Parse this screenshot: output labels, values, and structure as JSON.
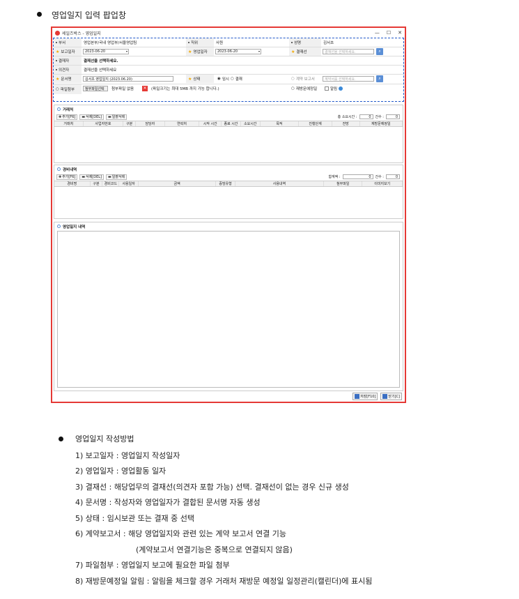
{
  "heading": "영업일지 입력 팝업창",
  "window": {
    "title": "세일즈박스 - 영업일지",
    "controls": [
      "—",
      "☐",
      "✕"
    ],
    "form": {
      "dept_label": "부서",
      "dept_value": "영업본부/국내 영업부/서울영업팀",
      "position_label": "직위",
      "position_value": "사원",
      "name_label": "성명",
      "name_value": "김서초",
      "report_date_label": "보고일자",
      "report_date_value": "2023-06-20",
      "sales_date_label": "영업일자",
      "sales_date_value": "2023-06-20",
      "approval_label": "결재선",
      "approval_placeholder": "결재선을 선택하세요.",
      "approver_label": "결재자",
      "approver_value": "결재선을 선택하세요.",
      "reviewer_label": "의견자",
      "reviewer_value": "결재선을 선택하세요",
      "docname_label": "문서명",
      "docname_value": "김서초 영업일지 (2023.06.20)",
      "status_label": "상태",
      "status_opt1": "임시",
      "status_opt2": "결재",
      "contract_label": "계약 보고서",
      "contract_placeholder": "계약서를 선택하세요.",
      "attach_label": "파일첨부",
      "attach_btn": "첨부파일선택",
      "attach_none": "첨부파일 없음",
      "attach_note": "(파일크기는 최대 5MB 까지 가능 합니다.)",
      "revisit_label": "재방문예정일",
      "alarm_label": "알림"
    },
    "client": {
      "title": "거래처",
      "add": "추가[F6]",
      "del": "삭제[DEL]",
      "delall": "일괄삭제",
      "total_time_label": "총 소요시간 :",
      "total_time": "0",
      "count_label": "건수 :",
      "count": "0",
      "columns": [
        "거래처",
        "사업자번호",
        "구분",
        "담당자",
        "연락처",
        "시작 시간",
        "종료 시간",
        "소요시간",
        "목적",
        "진행단계",
        "전망",
        "재방문예정일"
      ]
    },
    "expense": {
      "title": "경비내역",
      "add": "추가[F6]",
      "del": "삭제[DEL]",
      "delall": "일괄삭제",
      "sum_label": "합계액 :",
      "sum": "0",
      "count_label": "건수 :",
      "count": "0",
      "columns": [
        "경비명",
        "구분",
        "경비코드",
        "사용일자",
        "금액",
        "증빙유형",
        "사용내역",
        "첨부파일",
        "이미지보기"
      ]
    },
    "content": {
      "title": "영업일지 내역"
    },
    "buttons": {
      "save": "저장[F10]",
      "close": "닫기[C]"
    }
  },
  "guide": {
    "title": "영업일지 작성방법",
    "items": [
      "1) 보고일자 : 영업일지 작성일자",
      "2) 영업일자 : 영업활동 일자",
      "3) 결재선 : 해당업무의 결재선(의견자 포함 가능) 선택. 결재선이 없는 경우 신규 생성",
      "4) 문서명 : 작성자와 영업일자가 결합된 문서명 자동 생성",
      "5) 상태 : 임시보관 또는 결재 중 선택",
      "6) 계약보고서 : 해당 영업일지와 관련 있는 계약 보고서 연결 기능",
      "(계약보고서 연결기능은 중복으로 연결되지 않음)",
      "7) 파일첨부 : 영업일지 보고에 필요한 파일 첨부",
      "8) 재방문예정일 알림 :  알림을 체크할 경우 거래처 재방문 예정일 일정관리(캘린더)에 표시됨"
    ]
  }
}
